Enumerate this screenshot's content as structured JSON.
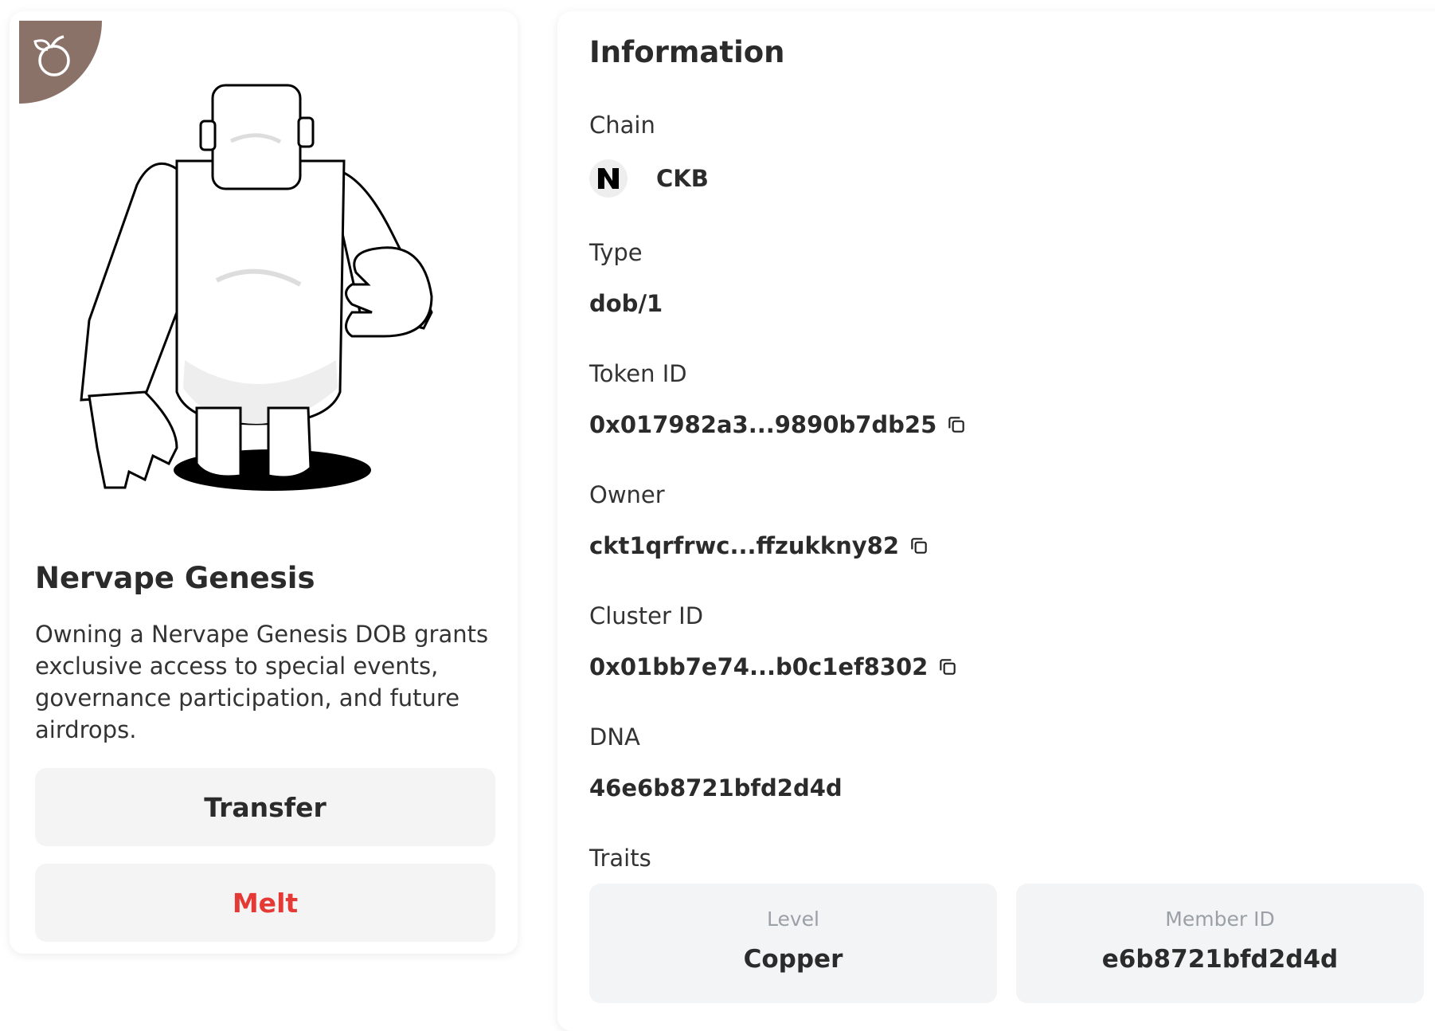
{
  "nft": {
    "name": "Nervape Genesis",
    "description": "Owning a Nervape Genesis DOB grants exclusive access to special events, governance participation, and future airdrops.",
    "transfer_label": "Transfer",
    "melt_label": "Melt",
    "badge_icon": "peach-icon"
  },
  "info": {
    "title": "Information",
    "chain_label": "Chain",
    "chain_value": "CKB",
    "chain_icon": "nervos-logo-icon",
    "type_label": "Type",
    "type_value": "dob/1",
    "token_label": "Token ID",
    "token_value": "0x017982a3...9890b7db25",
    "owner_label": "Owner",
    "owner_value": "ckt1qrfrwc...ffzukkny82",
    "cluster_label": "Cluster ID",
    "cluster_value": "0x01bb7e74...b0c1ef8302",
    "dna_label": "DNA",
    "dna_value": "46e6b8721bfd2d4d",
    "traits_label": "Traits",
    "traits": [
      {
        "label": "Level",
        "value": "Copper"
      },
      {
        "label": "Member ID",
        "value": "e6b8721bfd2d4d"
      }
    ]
  },
  "colors": {
    "melt": "#e53935",
    "badge": "#8a7268",
    "button_bg": "#f4f4f5"
  }
}
